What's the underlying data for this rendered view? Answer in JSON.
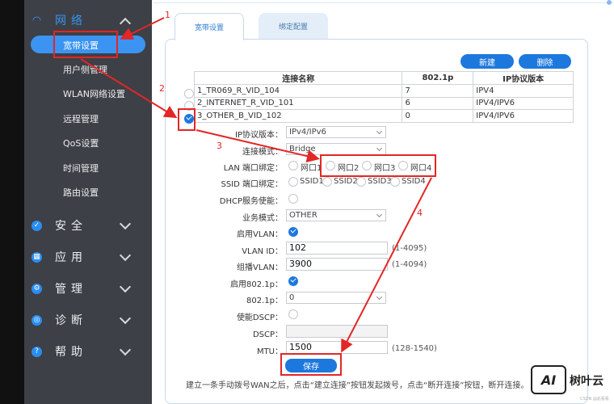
{
  "sidebar": {
    "network": {
      "label": "网络",
      "icon": "wifi-icon"
    },
    "network_items": [
      "宽带设置",
      "用户侧管理",
      "WLAN网络设置",
      "远程管理",
      "QoS设置",
      "时间管理",
      "路由设置"
    ],
    "sections": [
      {
        "label": "安全",
        "icon": "shield-icon"
      },
      {
        "label": "应用",
        "icon": "apps-icon"
      },
      {
        "label": "管理",
        "icon": "gear-icon"
      },
      {
        "label": "诊断",
        "icon": "diagnose-icon"
      },
      {
        "label": "帮助",
        "icon": "help-icon"
      }
    ]
  },
  "tabs": [
    "宽带设置",
    "绑定配置"
  ],
  "toolbar": {
    "new_label": "新建",
    "delete_label": "删除"
  },
  "table": {
    "headers": [
      "连接名称",
      "802.1p",
      "IP协议版本"
    ],
    "rows": [
      {
        "name": "1_TR069_R_VID_104",
        "p": "7",
        "ip": "IPV4",
        "selected": false
      },
      {
        "name": "2_INTERNET_R_VID_101",
        "p": "6",
        "ip": "IPV4/IPV6",
        "selected": false
      },
      {
        "name": "3_OTHER_B_VID_102",
        "p": "0",
        "ip": "IPV4/IPV6",
        "selected": true
      }
    ]
  },
  "form": {
    "ip_version_label": "IP协议版本：",
    "ip_version_value": "IPv4/IPv6",
    "conn_mode_label": "连接模式：",
    "conn_mode_value": "Bridge",
    "lan_bind_label": "LAN 端口绑定：",
    "lan_ports": [
      "网口1",
      "网口2",
      "网口3",
      "网口4"
    ],
    "ssid_bind_label": "SSID 端口绑定：",
    "ssids": [
      "SSID1",
      "SSID2",
      "SSID3",
      "SSID4"
    ],
    "dhcp_label": "DHCP服务使能：",
    "service_mode_label": "业务模式：",
    "service_mode_value": "OTHER",
    "vlan_enable_label": "启用VLAN：",
    "vlan_id_label": "VLAN ID：",
    "vlan_id_value": "102",
    "vlan_id_hint": "(1-4095)",
    "group_vlan_label": "组播VLAN：",
    "group_vlan_value": "3900",
    "group_vlan_hint": "(1-4094)",
    "enable_8021p_label": "启用802.1p：",
    "p8021_label": "802.1p：",
    "p8021_value": "0",
    "dscp_enable_label": "使能DSCP：",
    "dscp_label": "DSCP：",
    "mtu_label": "MTU：",
    "mtu_value": "1500",
    "mtu_hint": "(128-1540)",
    "save_label": "保存"
  },
  "footnote": "建立一条手动拨号WAN之后，点击“建立连接”按钮发起拨号，点击“断开连接”按钮，断开连接。",
  "annotations": [
    "1",
    "2",
    "3",
    "4"
  ],
  "watermark": {
    "logo": "AI",
    "text": "树叶云",
    "small": "CSDN @此看看"
  },
  "colors": {
    "accent": "#1d78de",
    "annotation": "#e32626",
    "sidebar_bg": "#3d4047"
  }
}
